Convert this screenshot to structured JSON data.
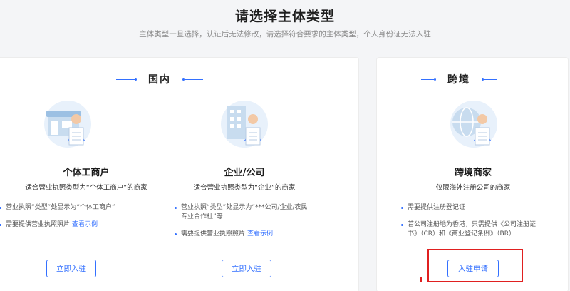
{
  "header": {
    "title": "请选择主体类型",
    "subtitle": "主体类型一旦选择，认证后无法修改，请选择符合要求的主体类型，个人身份证无法入驻"
  },
  "domestic": {
    "title": "国内",
    "individual": {
      "name": "个体工商户",
      "desc": "适合营业执照类型为“个体工商户”的商家",
      "req1": "营业执照“类型”处显示为“个体工商户”",
      "req2_text": "需要提供营业执照照片",
      "req2_link": "查看示例",
      "button": "立即入驻"
    },
    "company": {
      "name": "企业/公司",
      "desc": "适合营业执照类型为“企业”的商家",
      "req1_line1": "营业执照“类型”处显示为“***公司/企业/农民",
      "req1_line2": "专业合作社”等",
      "req2_text": "需要提供营业执照照片",
      "req2_link": "查看示例",
      "button": "立即入驻"
    }
  },
  "cross_border": {
    "title": "跨境",
    "merchant": {
      "name": "跨境商家",
      "desc": "仅限海外注册公司的商家",
      "req1": "需要提供注册登记证",
      "req2_line1": "若公司注册地为香港，只需提供《公司注册证",
      "req2_line2": "书》（CR）和《商业登记条例》（BR）",
      "button": "入驻申请"
    }
  },
  "colors": {
    "accent": "#3370ff",
    "highlight": "#e02020"
  },
  "icons": [
    "shop-illustration",
    "office-building-illustration",
    "globe-illustration",
    "certificate-icon"
  ]
}
